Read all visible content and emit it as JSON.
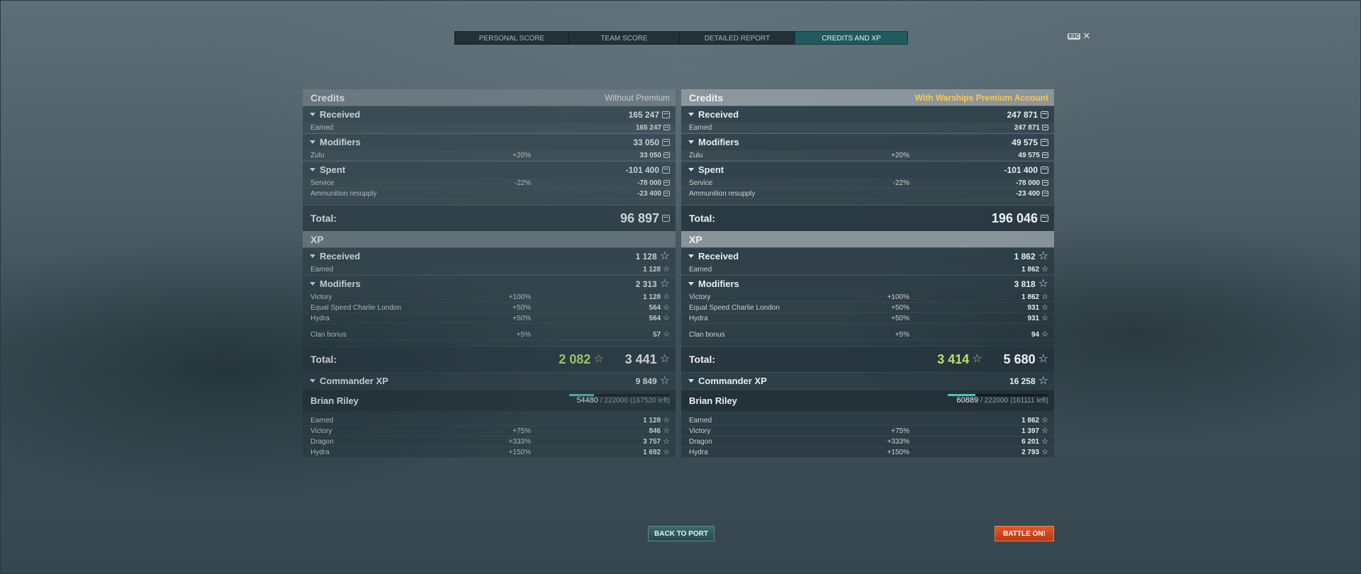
{
  "tabs": [
    {
      "label": "PERSONAL SCORE",
      "active": false
    },
    {
      "label": "TEAM SCORE",
      "active": false
    },
    {
      "label": "DETAILED REPORT",
      "active": false
    },
    {
      "label": "CREDITS AND XP",
      "active": true
    }
  ],
  "esc": {
    "key": "ESC",
    "close_icon": "close-icon"
  },
  "columns": {
    "left": {
      "credits_title": "Credits",
      "credits_sub": "Without Premium",
      "received": {
        "label": "Received",
        "value": "165 247",
        "rows": [
          {
            "name": "Earned",
            "mod": "",
            "value": "165 247"
          }
        ]
      },
      "modifiers": {
        "label": "Modifiers",
        "value": "33 050",
        "rows": [
          {
            "name": "Zulu",
            "mod": "+20%",
            "value": "33 050"
          }
        ]
      },
      "spent": {
        "label": "Spent",
        "value": "-101 400",
        "rows": [
          {
            "name": "Service",
            "mod": "-22%",
            "value": "-78 000"
          },
          {
            "name": "Ammunition resupply",
            "mod": "",
            "value": "-23 400"
          }
        ]
      },
      "credits_total_label": "Total:",
      "credits_total": "96 897",
      "xp_title": "XP",
      "xp_received": {
        "label": "Received",
        "value": "1 128",
        "rows": [
          {
            "name": "Earned",
            "mod": "",
            "value": "1 128"
          }
        ]
      },
      "xp_modifiers": {
        "label": "Modifiers",
        "value": "2 313",
        "rows": [
          {
            "name": "Victory",
            "mod": "+100%",
            "value": "1 128"
          },
          {
            "name": "Equal Speed Charlie London",
            "mod": "+50%",
            "value": "564"
          },
          {
            "name": "Hydra",
            "mod": "+50%",
            "value": "564"
          }
        ],
        "extra_rows": [
          {
            "name": "Clan bonus",
            "mod": "+5%",
            "value": "57"
          }
        ]
      },
      "xp_total_label": "Total:",
      "xp_total_free": "2 082",
      "xp_total": "3 441",
      "commander": {
        "label": "Commander XP",
        "value": "9 849",
        "name": "Brian Riley",
        "current": "54480",
        "needed": "/ 222000",
        "left": "(167520 left)",
        "progress": 0.245,
        "rows": [
          {
            "name": "Earned",
            "mod": "",
            "value": "1 128"
          },
          {
            "name": "Victory",
            "mod": "+75%",
            "value": "846"
          },
          {
            "name": "Dragon",
            "mod": "+333%",
            "value": "3 757"
          },
          {
            "name": "Hydra",
            "mod": "+150%",
            "value": "1 692"
          }
        ]
      }
    },
    "right": {
      "credits_title": "Credits",
      "credits_sub": "With Warships Premium Account",
      "received": {
        "label": "Received",
        "value": "247 871",
        "rows": [
          {
            "name": "Earned",
            "mod": "",
            "value": "247 871"
          }
        ]
      },
      "modifiers": {
        "label": "Modifiers",
        "value": "49 575",
        "rows": [
          {
            "name": "Zulu",
            "mod": "+20%",
            "value": "49 575"
          }
        ]
      },
      "spent": {
        "label": "Spent",
        "value": "-101 400",
        "rows": [
          {
            "name": "Service",
            "mod": "-22%",
            "value": "-78 000"
          },
          {
            "name": "Ammunition resupply",
            "mod": "",
            "value": "-23 400"
          }
        ]
      },
      "credits_total_label": "Total:",
      "credits_total": "196 046",
      "xp_title": "XP",
      "xp_received": {
        "label": "Received",
        "value": "1 862",
        "rows": [
          {
            "name": "Earned",
            "mod": "",
            "value": "1 862"
          }
        ]
      },
      "xp_modifiers": {
        "label": "Modifiers",
        "value": "3 818",
        "rows": [
          {
            "name": "Victory",
            "mod": "+100%",
            "value": "1 862"
          },
          {
            "name": "Equal Speed Charlie London",
            "mod": "+50%",
            "value": "931"
          },
          {
            "name": "Hydra",
            "mod": "+50%",
            "value": "931"
          }
        ],
        "extra_rows": [
          {
            "name": "Clan bonus",
            "mod": "+5%",
            "value": "94"
          }
        ]
      },
      "xp_total_label": "Total:",
      "xp_total_free": "3 414",
      "xp_total": "5 680",
      "commander": {
        "label": "Commander XP",
        "value": "16 258",
        "name": "Brian Riley",
        "current": "60889",
        "needed": "/ 222000",
        "left": "(161111 left)",
        "progress": 0.274,
        "rows": [
          {
            "name": "Earned",
            "mod": "",
            "value": "1 862"
          },
          {
            "name": "Victory",
            "mod": "+75%",
            "value": "1 397"
          },
          {
            "name": "Dragon",
            "mod": "+333%",
            "value": "6 201"
          },
          {
            "name": "Hydra",
            "mod": "+150%",
            "value": "2 793"
          }
        ]
      }
    }
  },
  "buttons": {
    "back_to_port": "BACK TO PORT",
    "battle_on": "BATTLE ON!"
  },
  "colors": {
    "accent_tab": "#1f5a5e",
    "premium": "#ffc94a",
    "free_xp": "#b6e36a",
    "battle_button": "#d24a20",
    "progress": "#3fc7c0"
  }
}
